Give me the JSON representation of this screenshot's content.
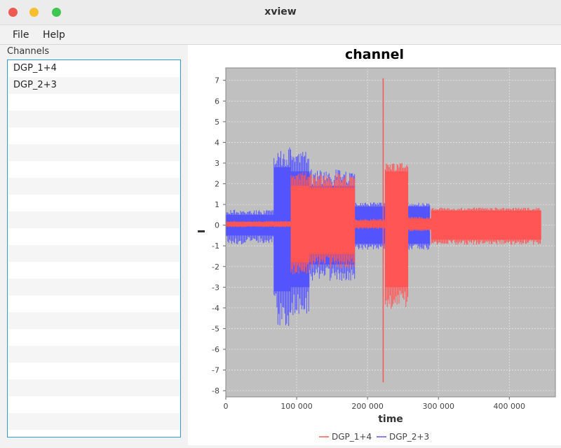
{
  "window": {
    "title": "xview"
  },
  "menu": {
    "items": [
      "File",
      "Help"
    ]
  },
  "channels": {
    "label": "Channels",
    "items": [
      "DGP_1+4",
      "DGP_2+3"
    ]
  },
  "chart_data": {
    "type": "line",
    "title": "channel",
    "xlabel": "time",
    "ylabel": "",
    "xlim": [
      0,
      465000
    ],
    "ylim": [
      -8.3,
      7.6
    ],
    "xticks": [
      0,
      100000,
      200000,
      300000,
      400000
    ],
    "xtick_labels": [
      "0",
      "100 000",
      "200 000",
      "300 000",
      "400 000"
    ],
    "yticks": [
      7,
      6,
      5,
      4,
      3,
      2,
      1,
      0,
      -1,
      -2,
      -3,
      -4,
      -5,
      -6,
      -7,
      -8
    ],
    "grid": true,
    "legend": "bottom",
    "series": [
      {
        "name": "DGP_2+3",
        "color": "#5555ff",
        "segments": [
          {
            "x": [
              0,
              68000
            ],
            "envelope": [
              -0.95,
              0.75
            ],
            "dense": [
              -0.5,
              0.5
            ]
          },
          {
            "x": [
              68000,
              92000
            ],
            "envelope": [
              -4.9,
              3.8
            ],
            "dense": [
              -3.2,
              2.8
            ]
          },
          {
            "x": [
              92000,
              118000
            ],
            "envelope": [
              -4.4,
              3.6
            ],
            "dense": [
              -3.0,
              2.6
            ]
          },
          {
            "x": [
              118000,
              182000
            ],
            "envelope": [
              -2.7,
              2.7
            ],
            "dense": [
              -1.9,
              1.9
            ]
          },
          {
            "x": [
              182000,
              228000
            ],
            "envelope": [
              -1.2,
              1.1
            ],
            "dense": [
              -0.9,
              0.9
            ]
          },
          {
            "x": [
              228000,
              288000
            ],
            "envelope": [
              -1.2,
              1.1
            ],
            "dense": [
              -0.9,
              0.9
            ]
          }
        ]
      },
      {
        "name": "DGP_1+4",
        "color": "#ff5555",
        "segments": [
          {
            "x": [
              0,
              92000
            ],
            "envelope": [
              -0.1,
              0.2
            ],
            "dense": [
              -0.05,
              0.15
            ]
          },
          {
            "x": [
              92000,
              118000
            ],
            "envelope": [
              -2.4,
              2.6
            ],
            "dense": [
              -1.8,
              1.9
            ]
          },
          {
            "x": [
              118000,
              182000
            ],
            "envelope": [
              -2.1,
              2.5
            ],
            "dense": [
              -1.4,
              1.8
            ]
          },
          {
            "x": [
              182000,
              225000
            ],
            "envelope": [
              -0.2,
              0.3
            ],
            "dense": [
              -0.1,
              0.2
            ]
          },
          {
            "x": [
              225000,
              257000
            ],
            "envelope": [
              -4.1,
              3.1
            ],
            "dense": [
              -3.0,
              2.6
            ]
          },
          {
            "x": [
              257000,
              290000
            ],
            "envelope": [
              -0.3,
              0.4
            ],
            "dense": [
              -0.2,
              0.3
            ]
          },
          {
            "x": [
              290000,
              445000
            ],
            "envelope": [
              -0.95,
              0.85
            ],
            "dense": [
              -0.7,
              0.7
            ]
          }
        ],
        "spikes": [
          {
            "x": 222000,
            "min": -7.6,
            "max": 7.1
          }
        ]
      }
    ]
  }
}
